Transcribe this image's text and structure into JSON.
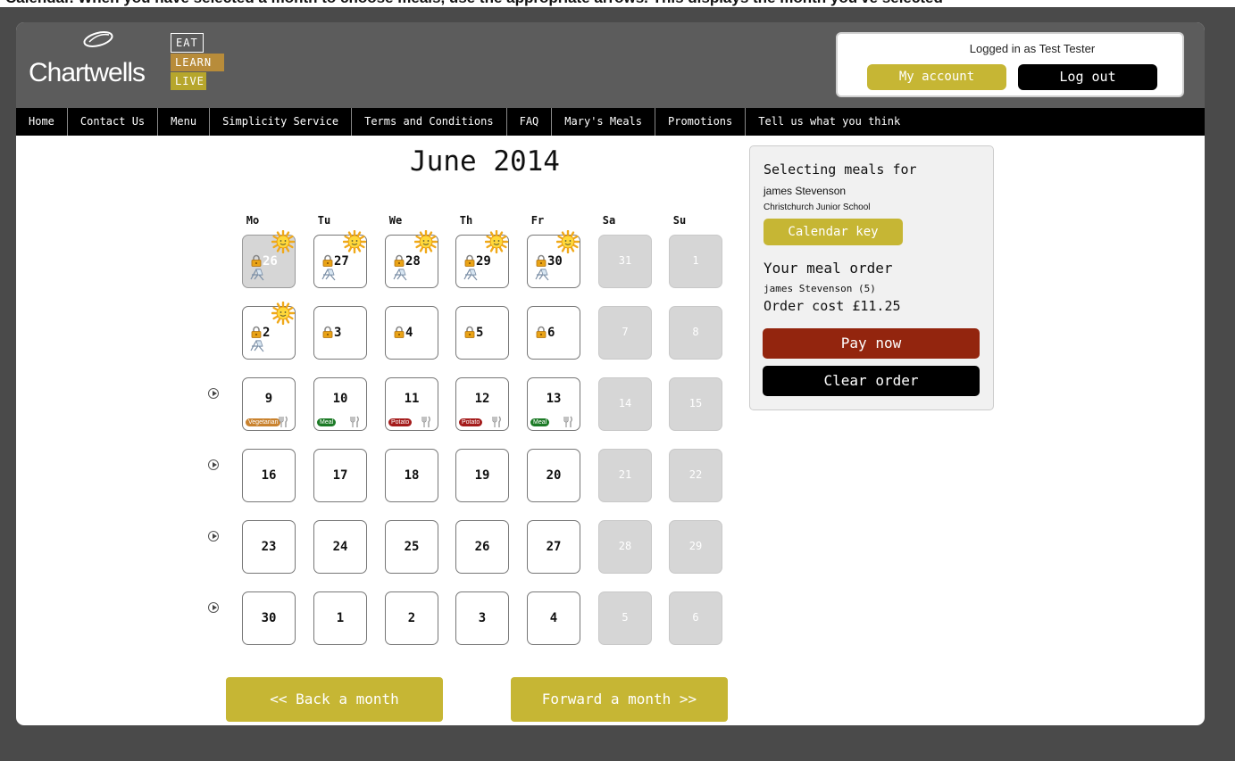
{
  "caption": "Calendar. When you have selected a month to choose meals, use the appropriate arrows. This displays the month you've selected",
  "brand": {
    "logo_text": "Chartwells",
    "tagline": [
      "EAT",
      "LEARN",
      "LIVE"
    ],
    "colors": {
      "gold": "#c6b634",
      "pay": "#93250e",
      "header": "#5c5c5c"
    }
  },
  "account": {
    "logged_in_text": "Logged in as Test Tester",
    "my_account_label": "My account",
    "logout_label": "Log out"
  },
  "nav": [
    "Home",
    "Contact Us",
    "Menu",
    "Simplicity Service",
    "Terms and Conditions",
    "FAQ",
    "Mary's Meals",
    "Promotions",
    "Tell us what you think"
  ],
  "calendar": {
    "month_title": "June 2014",
    "weekdays": [
      "Mo",
      "Tu",
      "We",
      "Th",
      "Fr",
      "Sa",
      "Su"
    ],
    "weeks": [
      [
        {
          "day": "26",
          "state": "past",
          "lock": true,
          "sun": true,
          "chair": true
        },
        {
          "day": "27",
          "state": "locked",
          "lock": true,
          "sun": true,
          "chair": true
        },
        {
          "day": "28",
          "state": "locked",
          "lock": true,
          "sun": true,
          "chair": true
        },
        {
          "day": "29",
          "state": "locked",
          "lock": true,
          "sun": true,
          "chair": true
        },
        {
          "day": "30",
          "state": "locked",
          "lock": true,
          "sun": true,
          "chair": true
        },
        {
          "day": "31",
          "state": "weekend"
        },
        {
          "day": "1",
          "state": "weekend"
        }
      ],
      [
        {
          "day": "2",
          "state": "locked",
          "lock": true,
          "sun": true,
          "chair": true
        },
        {
          "day": "3",
          "state": "locked",
          "lock": true
        },
        {
          "day": "4",
          "state": "locked",
          "lock": true
        },
        {
          "day": "5",
          "state": "locked",
          "lock": true
        },
        {
          "day": "6",
          "state": "locked",
          "lock": true
        },
        {
          "day": "7",
          "state": "weekend"
        },
        {
          "day": "8",
          "state": "weekend"
        }
      ],
      [
        {
          "day": "9",
          "state": "meal",
          "meal": "Vegetarian",
          "meal_color": "#c9822e"
        },
        {
          "day": "10",
          "state": "meal",
          "meal": "Meal",
          "meal_color": "#1c7a26"
        },
        {
          "day": "11",
          "state": "meal",
          "meal": "Potato",
          "meal_color": "#a41c1c"
        },
        {
          "day": "12",
          "state": "meal",
          "meal": "Potato",
          "meal_color": "#a41c1c"
        },
        {
          "day": "13",
          "state": "meal",
          "meal": "Meal",
          "meal_color": "#1c7a26"
        },
        {
          "day": "14",
          "state": "weekend"
        },
        {
          "day": "15",
          "state": "weekend"
        }
      ],
      [
        {
          "day": "16",
          "state": "open"
        },
        {
          "day": "17",
          "state": "open"
        },
        {
          "day": "18",
          "state": "open"
        },
        {
          "day": "19",
          "state": "open"
        },
        {
          "day": "20",
          "state": "open"
        },
        {
          "day": "21",
          "state": "weekend"
        },
        {
          "day": "22",
          "state": "weekend"
        }
      ],
      [
        {
          "day": "23",
          "state": "open"
        },
        {
          "day": "24",
          "state": "open"
        },
        {
          "day": "25",
          "state": "open"
        },
        {
          "day": "26",
          "state": "open"
        },
        {
          "day": "27",
          "state": "open"
        },
        {
          "day": "28",
          "state": "weekend"
        },
        {
          "day": "29",
          "state": "weekend"
        }
      ],
      [
        {
          "day": "30",
          "state": "open"
        },
        {
          "day": "1",
          "state": "open"
        },
        {
          "day": "2",
          "state": "open"
        },
        {
          "day": "3",
          "state": "open"
        },
        {
          "day": "4",
          "state": "open"
        },
        {
          "day": "5",
          "state": "weekend"
        },
        {
          "day": "6",
          "state": "weekend"
        }
      ]
    ],
    "back_label": "<< Back a month",
    "forward_label": "Forward a month >>"
  },
  "side_panel": {
    "title": "Selecting meals for",
    "child_name": "james Stevenson",
    "school": "Christchurch Junior School",
    "calendar_key_label": "Calendar key",
    "order_title": "Your meal order",
    "order_child": "james Stevenson (5)",
    "order_cost": "Order cost £11.25",
    "pay_label": "Pay now",
    "clear_label": "Clear order"
  }
}
